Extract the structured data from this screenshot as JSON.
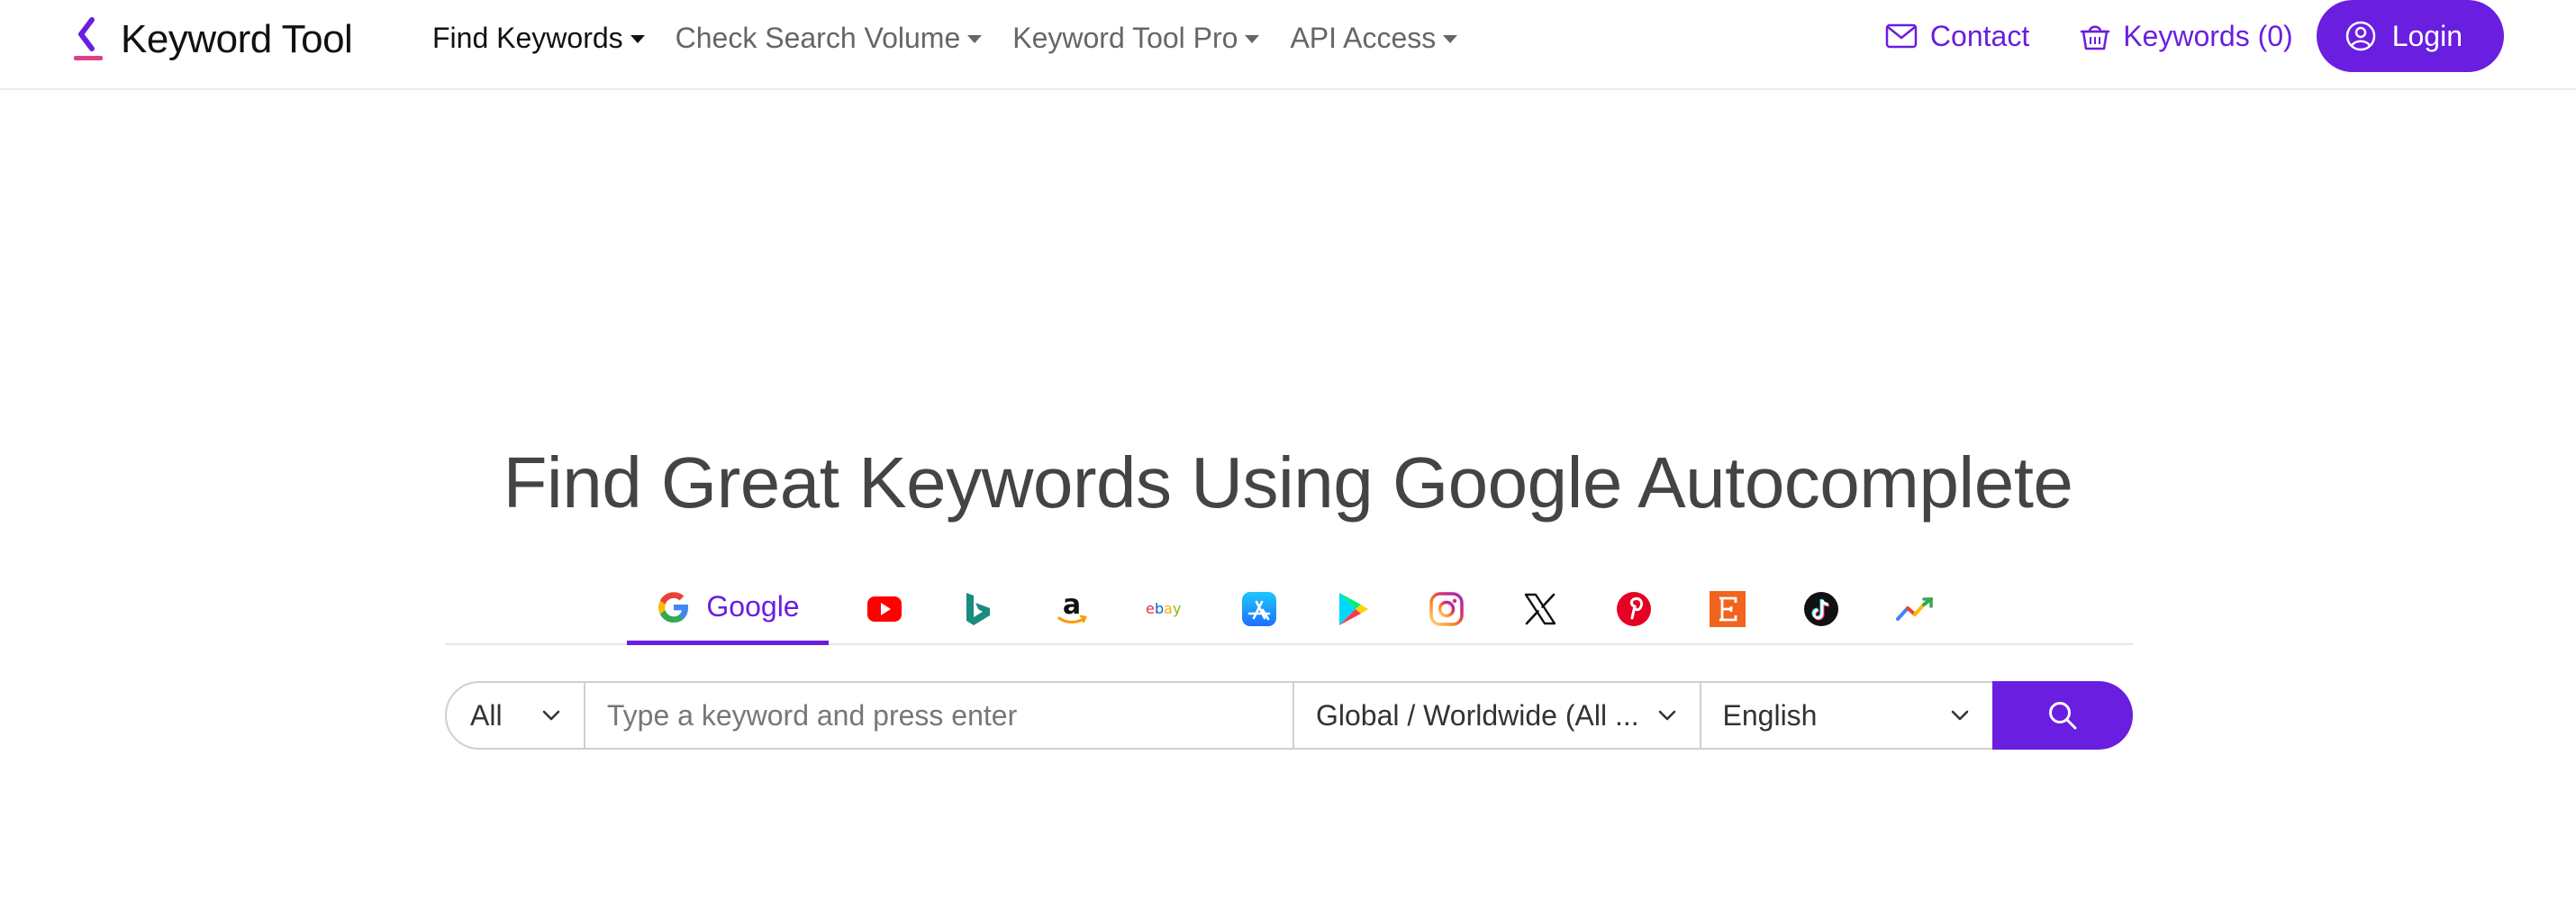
{
  "brand": {
    "name": "Keyword Tool",
    "accent": "#6a1ee0",
    "mark_color": "#e0408a"
  },
  "nav": {
    "items": [
      {
        "label": "Find Keywords",
        "active": true
      },
      {
        "label": "Check Search Volume",
        "active": false
      },
      {
        "label": "Keyword Tool Pro",
        "active": false
      },
      {
        "label": "API Access",
        "active": false
      }
    ],
    "contact_label": "Contact",
    "keywords_label": "Keywords (0)",
    "login_label": "Login"
  },
  "hero": {
    "title": "Find Great Keywords Using Google Autocomplete"
  },
  "platforms": [
    {
      "name": "Google",
      "icon": "google-icon",
      "active": true
    },
    {
      "name": "YouTube",
      "icon": "youtube-icon",
      "active": false
    },
    {
      "name": "Bing",
      "icon": "bing-icon",
      "active": false
    },
    {
      "name": "Amazon",
      "icon": "amazon-icon",
      "active": false
    },
    {
      "name": "eBay",
      "icon": "ebay-icon",
      "active": false
    },
    {
      "name": "App Store",
      "icon": "app-store-icon",
      "active": false
    },
    {
      "name": "Play Store",
      "icon": "play-store-icon",
      "active": false
    },
    {
      "name": "Instagram",
      "icon": "instagram-icon",
      "active": false
    },
    {
      "name": "X",
      "icon": "x-icon",
      "active": false
    },
    {
      "name": "Pinterest",
      "icon": "pinterest-icon",
      "active": false
    },
    {
      "name": "Etsy",
      "icon": "etsy-icon",
      "active": false
    },
    {
      "name": "TikTok",
      "icon": "tiktok-icon",
      "active": false
    },
    {
      "name": "Trends",
      "icon": "trends-icon",
      "active": false
    }
  ],
  "search": {
    "type_value": "All",
    "placeholder": "Type a keyword and press enter",
    "location_value": "Global / Worldwide (All ...",
    "language_value": "English"
  }
}
